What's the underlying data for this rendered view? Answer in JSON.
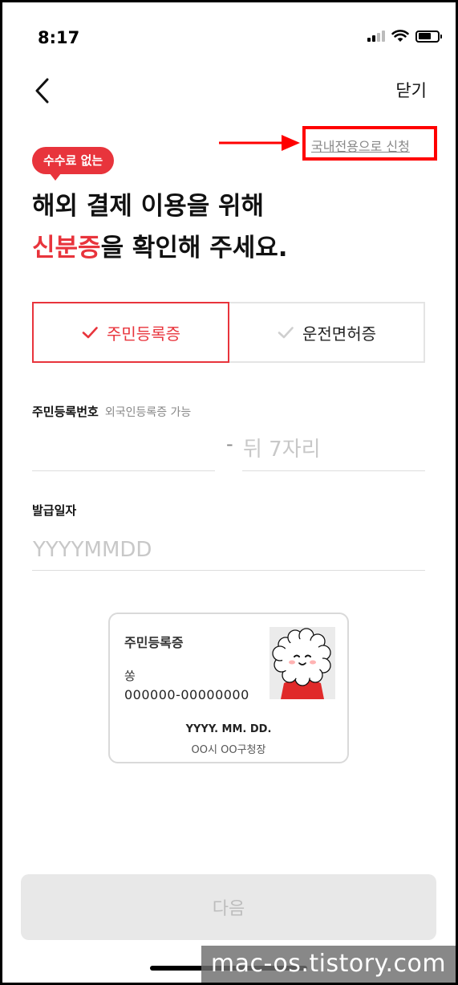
{
  "status_bar": {
    "time": "8:17",
    "signal_icon": "signal-icon",
    "wifi_icon": "wifi-icon",
    "battery_icon": "battery-icon"
  },
  "header": {
    "back_icon": "chevron-left-icon",
    "close_label": "닫기"
  },
  "domestic_link": "국내전용으로 신청",
  "annotation": {
    "arrow_color": "#ff0000",
    "box_color": "#ff0000"
  },
  "badge": {
    "label": "수수료 없는"
  },
  "headline": {
    "line1": "해외 결제 이용을 위해",
    "accent": "신분증",
    "line2_rest": "을 확인해 주세요."
  },
  "id_tabs": [
    {
      "label": "주민등록증",
      "selected": true,
      "icon": "check-icon"
    },
    {
      "label": "운전면허증",
      "selected": false,
      "icon": "check-icon"
    }
  ],
  "resident_number": {
    "label": "주민등록번호",
    "hint": "외국인등록증 가능",
    "front_value": "",
    "separator": "-",
    "back_placeholder": "뒤 7자리"
  },
  "issue_date": {
    "label": "발급일자",
    "placeholder": "YYYYMMDD"
  },
  "sample_card": {
    "title": "주민등록증",
    "name": "쏭",
    "number": "000000-00000000",
    "date": "YYYY. MM. DD.",
    "issuer": "OO시 OO구청장",
    "photo_icon": "mascot-photo"
  },
  "next_button": {
    "label": "다음",
    "enabled": false
  },
  "watermark": "mac-os.tistory.com",
  "colors": {
    "accent": "#e8343c",
    "disabled_bg": "#e8e8e8",
    "disabled_text": "#bdbdbd"
  }
}
